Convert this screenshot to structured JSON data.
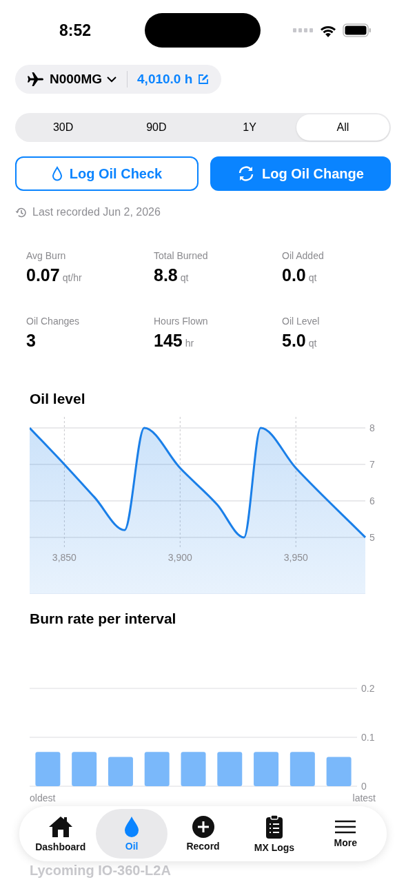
{
  "status_bar": {
    "time": "8:52"
  },
  "aircraft": {
    "tail": "N000MG",
    "hours": "4,010.0 h"
  },
  "ranges": [
    {
      "label": "30D",
      "selected": false
    },
    {
      "label": "90D",
      "selected": false
    },
    {
      "label": "1Y",
      "selected": false
    },
    {
      "label": "All",
      "selected": true
    }
  ],
  "actions": [
    {
      "label": "Log Oil Check",
      "kind": "outline"
    },
    {
      "label": "Log Oil Change",
      "kind": "filled"
    }
  ],
  "last_recorded": "Last recorded Jun 2, 2026",
  "stats": [
    {
      "label": "Avg Burn",
      "value": "0.07",
      "unit": "qt/hr"
    },
    {
      "label": "Total Burned",
      "value": "8.8",
      "unit": "qt"
    },
    {
      "label": "Oil Added",
      "value": "0.0",
      "unit": "qt"
    },
    {
      "label": "Oil Changes",
      "value": "3"
    },
    {
      "label": "Hours Flown",
      "value": "145",
      "unit": "hr"
    },
    {
      "label": "Oil Level",
      "value": "5.0",
      "unit": "qt"
    }
  ],
  "oil_chart": {
    "title": "Oil level",
    "chart_data": {
      "type": "area",
      "grid": true,
      "x": [
        3835,
        3850,
        3863,
        3876,
        3884.5,
        3900,
        3916,
        3927.6,
        3934.8,
        3950,
        3980
      ],
      "series": [
        {
          "color": "#1a7fe8",
          "values": [
            8,
            7,
            6.1,
            5.2,
            8,
            6.9,
            5.9,
            5.0,
            8,
            6.9,
            5
          ]
        }
      ],
      "xlim": [
        3835,
        3980
      ],
      "ylim": [
        3.45,
        8
      ],
      "xticks": [
        {
          "value": 3850,
          "label": "3,850"
        },
        {
          "value": 3900,
          "label": "3,900"
        },
        {
          "value": 3950,
          "label": "3,950"
        }
      ],
      "yticks": [
        5,
        6,
        7,
        8
      ]
    }
  },
  "burn_chart": {
    "title": "Burn rate per interval",
    "chart_data": {
      "type": "bar",
      "grid": true,
      "series": [
        {
          "color": "#7ab8fa",
          "values": [
            0.07,
            0.07,
            0.06,
            0.07,
            0.07,
            0.07,
            0.07,
            0.07,
            0.06
          ]
        }
      ],
      "yticks": [
        0,
        0.1,
        0.2
      ],
      "ylim": [
        0,
        0.2
      ]
    },
    "axis_ends": {
      "start": "oldest",
      "end": "latest"
    }
  },
  "tab_bar": [
    {
      "label": "Dashboard",
      "selected": false
    },
    {
      "label": "Oil",
      "selected": true
    },
    {
      "label": "Record",
      "selected": false
    },
    {
      "label": "MX Logs",
      "selected": false
    },
    {
      "label": "More",
      "selected": false
    }
  ],
  "engine": "Lycoming IO-360-L2A"
}
